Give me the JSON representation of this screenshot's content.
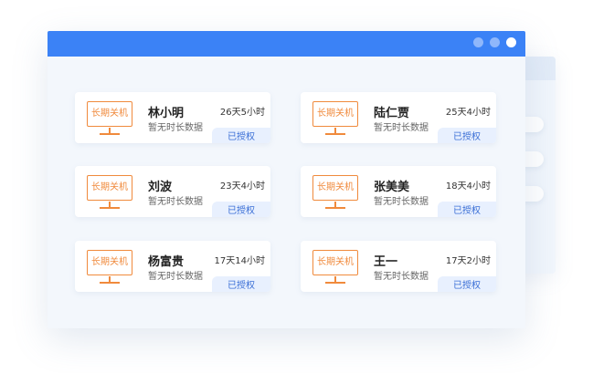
{
  "window": {
    "dots": [
      "dot",
      "dot",
      "dot"
    ]
  },
  "devices": [
    {
      "screen_label": "长期关机",
      "name": "林小明",
      "duration": "26天5小时",
      "note": "暂无时长数据",
      "badge": "已授权"
    },
    {
      "screen_label": "长期关机",
      "name": "陆仁贾",
      "duration": "25天4小时",
      "note": "暂无时长数据",
      "badge": "已授权"
    },
    {
      "screen_label": "长期关机",
      "name": "刘波",
      "duration": "23天4小时",
      "note": "暂无时长数据",
      "badge": "已授权"
    },
    {
      "screen_label": "长期关机",
      "name": "张美美",
      "duration": "18天4小时",
      "note": "暂无时长数据",
      "badge": "已授权"
    },
    {
      "screen_label": "长期关机",
      "name": "杨富贵",
      "duration": "17天14小时",
      "note": "暂无时长数据",
      "badge": "已授权"
    },
    {
      "screen_label": "长期关机",
      "name": "王一",
      "duration": "17天2小时",
      "note": "暂无时长数据",
      "badge": "已授权"
    }
  ],
  "colors": {
    "titlebar": "#3b82f6",
    "accent_orange": "#f08a3c",
    "badge_bg": "#e8f0fe",
    "badge_text": "#3b6fd6"
  }
}
